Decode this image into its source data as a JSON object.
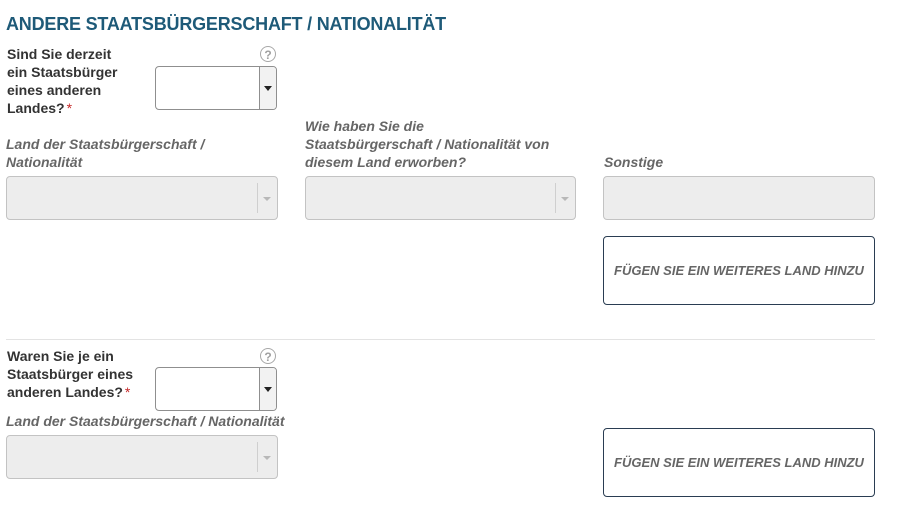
{
  "section": {
    "title": "ANDERE STAATSBÜRGERSCHAFT / NATIONALITÄT",
    "help_symbol": "?",
    "required_marker": "*"
  },
  "current": {
    "question": "Sind Sie derzeit ein Staatsbürger eines anderen Landes?",
    "answer": "",
    "country_label": "Land der Staatsbürgerschaft / Nationalität",
    "country_value": "",
    "acquired_label": "Wie haben Sie die Staatsbürgerschaft / Nationalität von diesem Land erworben?",
    "acquired_value": "",
    "other_label": "Sonstige",
    "other_value": "",
    "add_button": "FÜGEN SIE EIN WEITERES LAND HINZU"
  },
  "past": {
    "question": "Waren Sie je ein Staatsbürger eines anderen Landes?",
    "answer": "",
    "country_label": "Land der Staatsbürgerschaft / Nationalität",
    "country_value": "",
    "add_button": "FÜGEN SIE EIN WEITERES LAND HINZU"
  }
}
